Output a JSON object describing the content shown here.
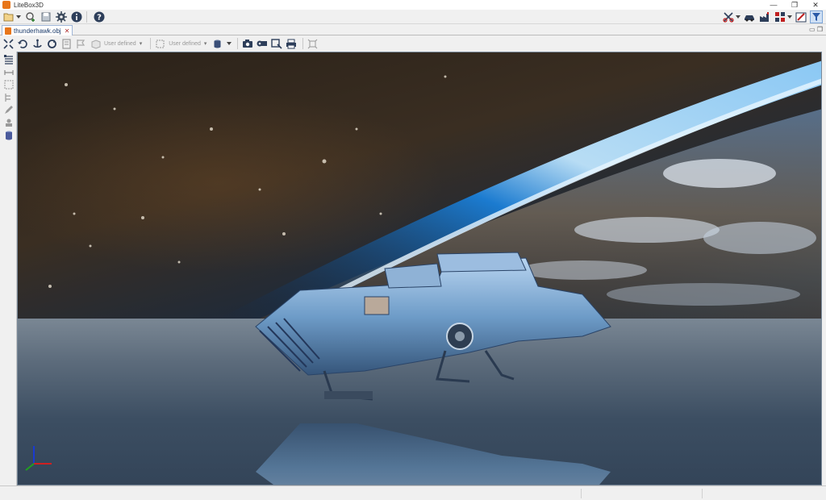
{
  "window": {
    "title": "LiteBox3D",
    "controls": {
      "minimize": "—",
      "maximize": "❐",
      "close": "✕"
    }
  },
  "main_toolbar": {
    "left_icons": [
      "open-folder-icon",
      "dropdown-arrow-icon",
      "add-model-icon",
      "save-icon",
      "settings-icon",
      "info-icon",
      "help-icon"
    ],
    "right_icons": [
      "scissors-icon",
      "car-view-icon",
      "factory-icon",
      "grid-render-icon",
      "palette-icon",
      "filter-icon"
    ]
  },
  "document": {
    "tab_label": "thunderhawk.obj",
    "mdi_controls": "▭ ❐"
  },
  "viewer_toolbar": {
    "dropdown_1": "User defined",
    "dropdown_2": "User defined",
    "icons": [
      "fit-view-icon",
      "rotate-icon",
      "anchor-icon",
      "refresh-icon",
      "book-icon",
      "flag-icon",
      "cube-icon",
      "cube-frame-icon",
      "cylinder-icon",
      "camera-icon",
      "video-camera-icon",
      "render-icon",
      "printer-icon",
      "expand-icon"
    ]
  },
  "left_toolbar": {
    "icons": [
      "layers-icon",
      "ruler-icon",
      "section-icon",
      "tree-icon",
      "pencil-icon",
      "stamp-icon",
      "cylinder-blue-icon"
    ]
  },
  "colors": {
    "accent_orange": "#e8761a",
    "tab_text": "#1a3a6a",
    "close_red": "#b03030"
  }
}
